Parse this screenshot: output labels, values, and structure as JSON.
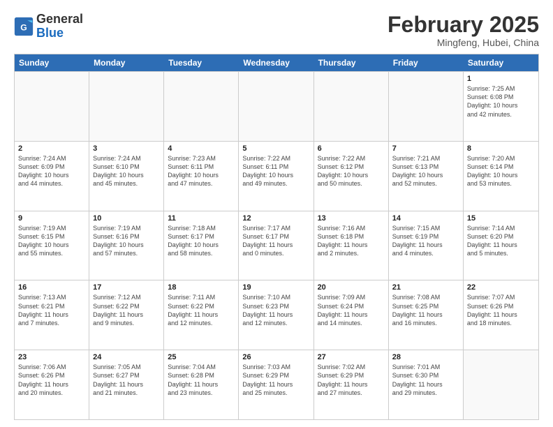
{
  "header": {
    "logo_general": "General",
    "logo_blue": "Blue",
    "month_year": "February 2025",
    "location": "Mingfeng, Hubei, China"
  },
  "weekdays": [
    "Sunday",
    "Monday",
    "Tuesday",
    "Wednesday",
    "Thursday",
    "Friday",
    "Saturday"
  ],
  "weeks": [
    [
      {
        "day": "",
        "info": ""
      },
      {
        "day": "",
        "info": ""
      },
      {
        "day": "",
        "info": ""
      },
      {
        "day": "",
        "info": ""
      },
      {
        "day": "",
        "info": ""
      },
      {
        "day": "",
        "info": ""
      },
      {
        "day": "1",
        "info": "Sunrise: 7:25 AM\nSunset: 6:08 PM\nDaylight: 10 hours\nand 42 minutes."
      }
    ],
    [
      {
        "day": "2",
        "info": "Sunrise: 7:24 AM\nSunset: 6:09 PM\nDaylight: 10 hours\nand 44 minutes."
      },
      {
        "day": "3",
        "info": "Sunrise: 7:24 AM\nSunset: 6:10 PM\nDaylight: 10 hours\nand 45 minutes."
      },
      {
        "day": "4",
        "info": "Sunrise: 7:23 AM\nSunset: 6:11 PM\nDaylight: 10 hours\nand 47 minutes."
      },
      {
        "day": "5",
        "info": "Sunrise: 7:22 AM\nSunset: 6:11 PM\nDaylight: 10 hours\nand 49 minutes."
      },
      {
        "day": "6",
        "info": "Sunrise: 7:22 AM\nSunset: 6:12 PM\nDaylight: 10 hours\nand 50 minutes."
      },
      {
        "day": "7",
        "info": "Sunrise: 7:21 AM\nSunset: 6:13 PM\nDaylight: 10 hours\nand 52 minutes."
      },
      {
        "day": "8",
        "info": "Sunrise: 7:20 AM\nSunset: 6:14 PM\nDaylight: 10 hours\nand 53 minutes."
      }
    ],
    [
      {
        "day": "9",
        "info": "Sunrise: 7:19 AM\nSunset: 6:15 PM\nDaylight: 10 hours\nand 55 minutes."
      },
      {
        "day": "10",
        "info": "Sunrise: 7:19 AM\nSunset: 6:16 PM\nDaylight: 10 hours\nand 57 minutes."
      },
      {
        "day": "11",
        "info": "Sunrise: 7:18 AM\nSunset: 6:17 PM\nDaylight: 10 hours\nand 58 minutes."
      },
      {
        "day": "12",
        "info": "Sunrise: 7:17 AM\nSunset: 6:17 PM\nDaylight: 11 hours\nand 0 minutes."
      },
      {
        "day": "13",
        "info": "Sunrise: 7:16 AM\nSunset: 6:18 PM\nDaylight: 11 hours\nand 2 minutes."
      },
      {
        "day": "14",
        "info": "Sunrise: 7:15 AM\nSunset: 6:19 PM\nDaylight: 11 hours\nand 4 minutes."
      },
      {
        "day": "15",
        "info": "Sunrise: 7:14 AM\nSunset: 6:20 PM\nDaylight: 11 hours\nand 5 minutes."
      }
    ],
    [
      {
        "day": "16",
        "info": "Sunrise: 7:13 AM\nSunset: 6:21 PM\nDaylight: 11 hours\nand 7 minutes."
      },
      {
        "day": "17",
        "info": "Sunrise: 7:12 AM\nSunset: 6:22 PM\nDaylight: 11 hours\nand 9 minutes."
      },
      {
        "day": "18",
        "info": "Sunrise: 7:11 AM\nSunset: 6:22 PM\nDaylight: 11 hours\nand 12 minutes."
      },
      {
        "day": "19",
        "info": "Sunrise: 7:10 AM\nSunset: 6:23 PM\nDaylight: 11 hours\nand 12 minutes."
      },
      {
        "day": "20",
        "info": "Sunrise: 7:09 AM\nSunset: 6:24 PM\nDaylight: 11 hours\nand 14 minutes."
      },
      {
        "day": "21",
        "info": "Sunrise: 7:08 AM\nSunset: 6:25 PM\nDaylight: 11 hours\nand 16 minutes."
      },
      {
        "day": "22",
        "info": "Sunrise: 7:07 AM\nSunset: 6:26 PM\nDaylight: 11 hours\nand 18 minutes."
      }
    ],
    [
      {
        "day": "23",
        "info": "Sunrise: 7:06 AM\nSunset: 6:26 PM\nDaylight: 11 hours\nand 20 minutes."
      },
      {
        "day": "24",
        "info": "Sunrise: 7:05 AM\nSunset: 6:27 PM\nDaylight: 11 hours\nand 21 minutes."
      },
      {
        "day": "25",
        "info": "Sunrise: 7:04 AM\nSunset: 6:28 PM\nDaylight: 11 hours\nand 23 minutes."
      },
      {
        "day": "26",
        "info": "Sunrise: 7:03 AM\nSunset: 6:29 PM\nDaylight: 11 hours\nand 25 minutes."
      },
      {
        "day": "27",
        "info": "Sunrise: 7:02 AM\nSunset: 6:29 PM\nDaylight: 11 hours\nand 27 minutes."
      },
      {
        "day": "28",
        "info": "Sunrise: 7:01 AM\nSunset: 6:30 PM\nDaylight: 11 hours\nand 29 minutes."
      },
      {
        "day": "",
        "info": ""
      }
    ]
  ]
}
